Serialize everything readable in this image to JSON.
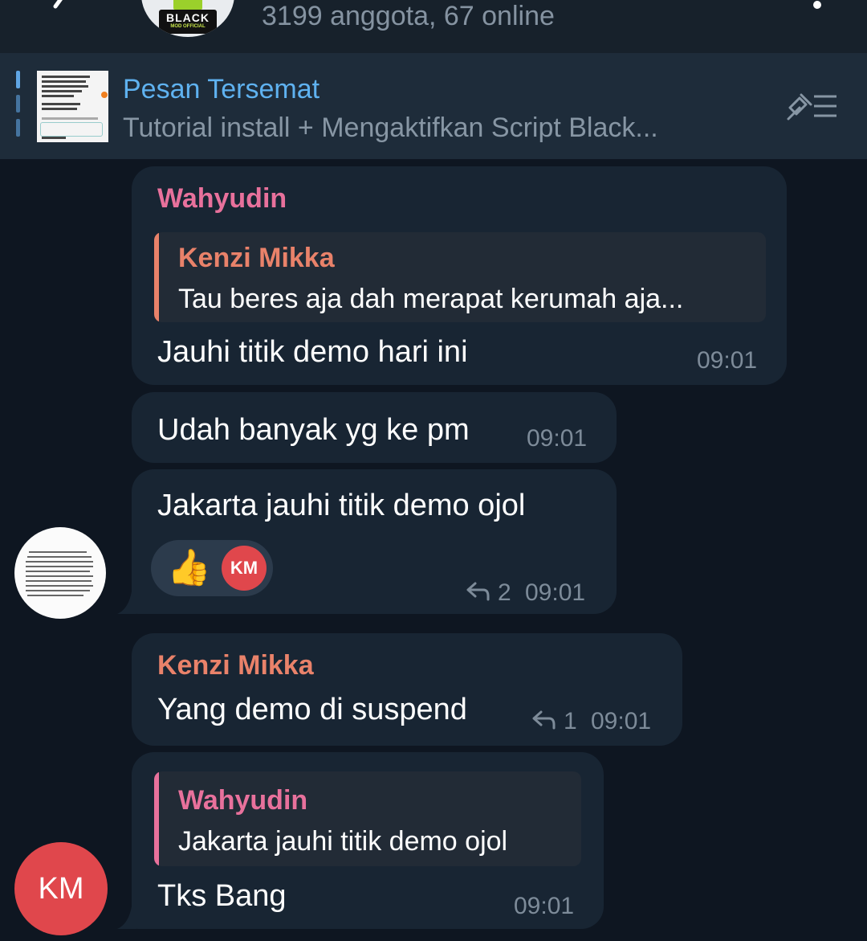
{
  "header": {
    "group_logo_text": "BLACK",
    "group_logo_sub": "MOD OFFICIAL",
    "members_status": "3199 anggota, 67 online"
  },
  "pinned": {
    "title": "Pesan Tersemat",
    "text": "Tutorial  install + Mengaktifkan Script Black..."
  },
  "colors": {
    "accent_blue": "#5fb2f0",
    "name_pink": "#e8719c",
    "name_orange": "#e9826a",
    "avatar_red": "#e0474c"
  },
  "messages": [
    {
      "sender": "Wahyudin",
      "reply_to": {
        "name": "Kenzi Mikka",
        "text": "Tau beres aja dah merapat kerumah aja..."
      },
      "text": "Jauhi titik demo hari ini",
      "time": "09:01"
    },
    {
      "text": "Udah banyak yg ke pm",
      "time": "09:01"
    },
    {
      "text": "Jakarta jauhi titik demo ojol",
      "reactions": [
        {
          "icon": "thumbs-up-icon",
          "emoji": "👍",
          "by": "KM"
        }
      ],
      "reply_count": "2",
      "time": "09:01"
    },
    {
      "sender": "Kenzi Mikka",
      "text": "Yang demo di suspend",
      "reply_count": "1",
      "time": "09:01"
    },
    {
      "reply_to": {
        "name": "Wahyudin",
        "text": "Jakarta jauhi titik demo ojol"
      },
      "text": "Tks Bang",
      "time": "09:01",
      "avatar_initials": "KM"
    }
  ]
}
